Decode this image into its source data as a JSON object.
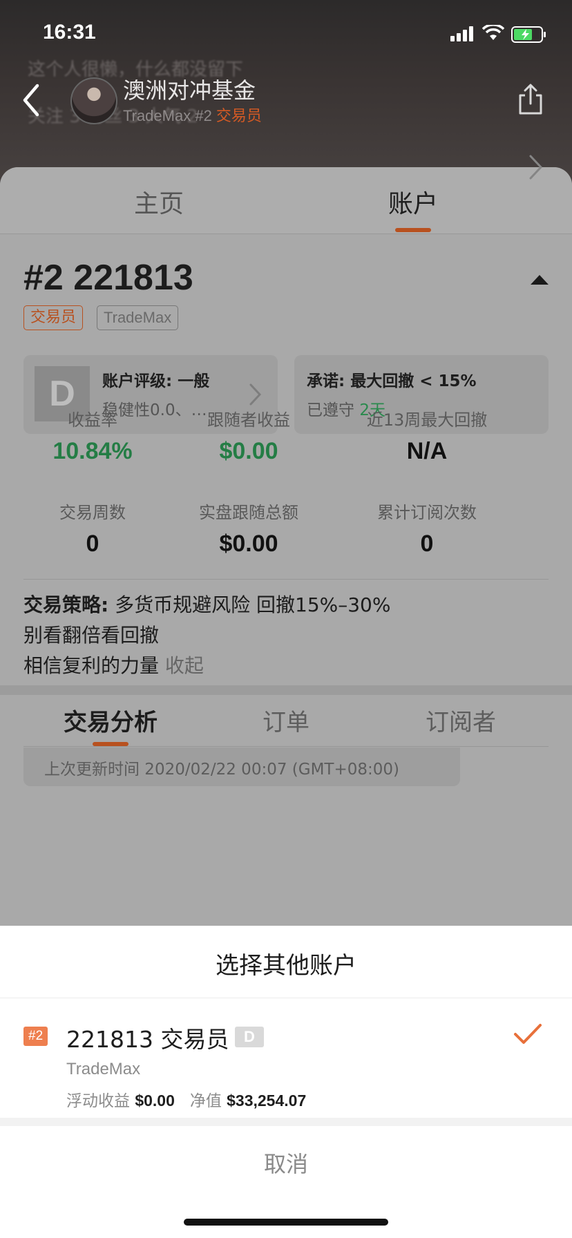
{
  "status": {
    "time": "16:31"
  },
  "header": {
    "ghost_line1": "这个人很懒，什么都没留下",
    "ghost_line2": "关注 3  粉丝 3  人气 2",
    "title": "澳洲对冲基金",
    "sub_prefix": "TradeMax #2 ",
    "sub_role": "交易员"
  },
  "tabs": {
    "home": "主页",
    "account": "账户"
  },
  "account": {
    "title": "#2 221813",
    "tag_role": "交易员",
    "tag_broker": "TradeMax",
    "grade_letter": "D",
    "rating_title": "账户评级: 一般",
    "rating_sub": "稳健性0.0、…",
    "promise_title": "承诺: 最大回撤 < 15%",
    "promise_sub_prefix": "已遵守 ",
    "promise_days": "2天"
  },
  "stats": {
    "return_label": "收益率",
    "return_value": "10.84%",
    "follower_label": "跟随者收益",
    "follower_value": "$0.00",
    "drawdown_label": "近13周最大回撤",
    "drawdown_value": "N/A",
    "weeks_label": "交易周数",
    "weeks_value": "0",
    "follow_total_label": "实盘跟随总额",
    "follow_total_value": "$0.00",
    "subs_label": "累计订阅次数",
    "subs_value": "0"
  },
  "strategy": {
    "label": "交易策略:",
    "line1": " 多货币规避风险  回撤15%–30%",
    "line2": "别看翻倍看回撤",
    "line3": "相信复利的力量",
    "collapse": " 收起"
  },
  "subtabs": {
    "analysis": "交易分析",
    "orders": "订单",
    "subscribers": "订阅者"
  },
  "update": {
    "text": "上次更新时间 2020/02/22 00:07 (GMT+08:00)"
  },
  "sheet": {
    "title": "选择其他账户",
    "badge": "#2",
    "name": "221813 交易员",
    "grade": "D",
    "broker": "TradeMax",
    "float_label": "浮动收益 ",
    "float_value": "$0.00",
    "equity_label": "净值 ",
    "equity_value": "$33,254.07",
    "cancel": "取消"
  },
  "colors": {
    "accent": "#e8703a",
    "green": "#2a8a4d"
  }
}
